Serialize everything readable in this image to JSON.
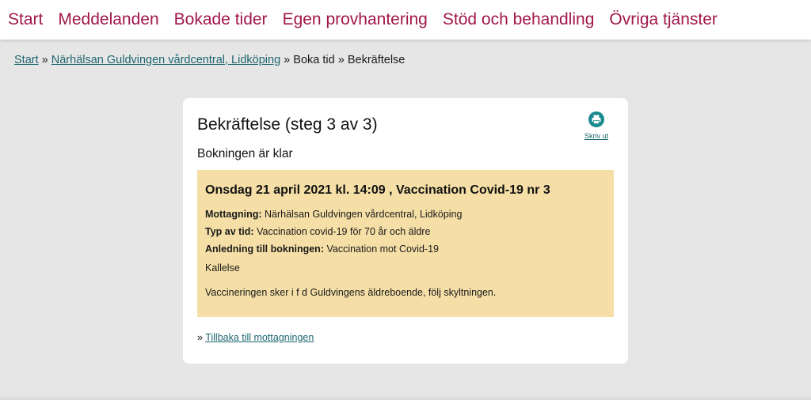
{
  "nav": {
    "items": [
      {
        "label": "Start"
      },
      {
        "label": "Meddelanden"
      },
      {
        "label": "Bokade tider"
      },
      {
        "label": "Egen provhantering"
      },
      {
        "label": "Stöd och behandling"
      },
      {
        "label": "Övriga tjänster"
      }
    ]
  },
  "breadcrumb": {
    "start": "Start",
    "sep": "»",
    "clinic": "Närhälsan Guldvingen vårdcentral, Lidköping",
    "book": "Boka tid",
    "current": "Bekräftelse"
  },
  "card": {
    "title": "Bekräftelse (steg 3 av 3)",
    "print_label": "Skriv ut",
    "print_icon": "printer-icon",
    "subtitle": "Bokningen är klar",
    "booking": {
      "heading": "Onsdag 21 april 2021 kl. 14:09 , Vaccination Covid-19 nr 3",
      "clinic_label": "Mottagning:",
      "clinic_value": "Närhälsan Guldvingen vårdcentral, Lidköping",
      "type_label": "Typ av tid:",
      "type_value": "Vaccination covid-19 för 70 år och äldre",
      "reason_label": "Anledning till bokningen:",
      "reason_value": "Vaccination mot Covid-19",
      "note1": "Kallelse",
      "note2": "Vaccineringen sker i f d Guldvingens äldreboende, följ skyltningen."
    },
    "back_prefix": "»",
    "back_link": "Tillbaka till mottagningen"
  },
  "colors": {
    "nav_text": "#a1174a",
    "link": "#1d6670",
    "page_bg": "#e6e6e6",
    "booking_bg": "#f5dfa6",
    "print_icon": "#1a8a8f"
  }
}
